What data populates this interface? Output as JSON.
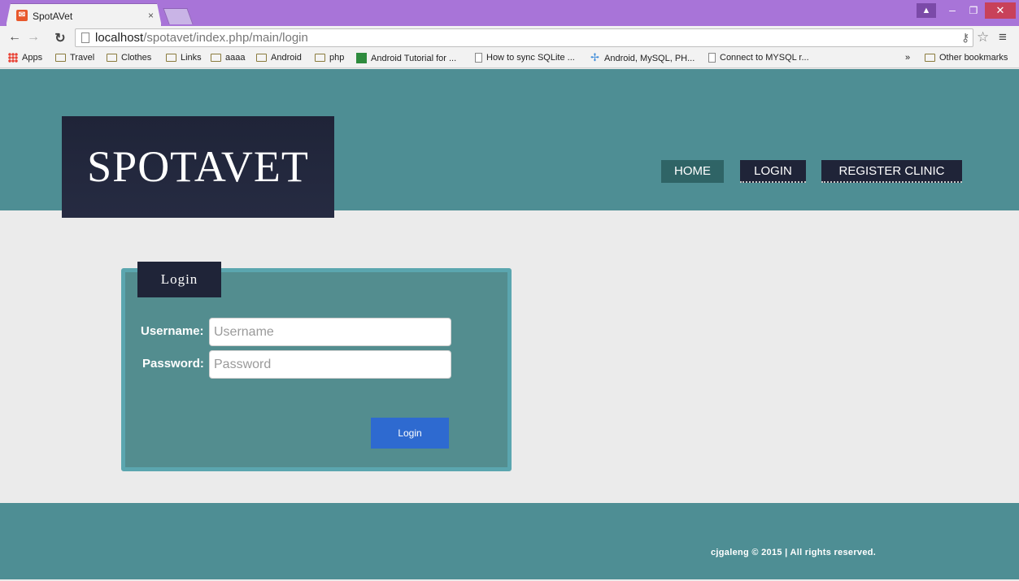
{
  "browser": {
    "tab_title": "SpotAVet",
    "tab_close": "×",
    "url_host": "localhost",
    "url_path": "/spotavet/index.php/main/login",
    "bookmarks": [
      {
        "label": "Apps",
        "icon": "apps-grid-icon"
      },
      {
        "label": "Travel",
        "icon": "folder-icon"
      },
      {
        "label": "Clothes",
        "icon": "folder-icon"
      },
      {
        "label": "Links",
        "icon": "folder-icon"
      },
      {
        "label": "aaaa",
        "icon": "folder-icon"
      },
      {
        "label": "Android",
        "icon": "folder-icon"
      },
      {
        "label": "php",
        "icon": "folder-icon"
      },
      {
        "label": "Android Tutorial for ...",
        "icon": "site-icon"
      },
      {
        "label": "How to sync SQLite ...",
        "icon": "page-icon"
      },
      {
        "label": "Android, MySQL, PH...",
        "icon": "site-icon"
      },
      {
        "label": "Connect to MYSQL r...",
        "icon": "page-icon"
      }
    ],
    "overflow": "»",
    "other_bookmarks": "Other bookmarks"
  },
  "header": {
    "logo": "SPOTAVET",
    "nav": {
      "home": "HOME",
      "login": "LOGIN",
      "register": "REGISTER CLINIC"
    }
  },
  "login_form": {
    "title": "Login",
    "username_label": "Username:",
    "username_placeholder": "Username",
    "password_label": "Password:",
    "password_placeholder": "Password",
    "submit": "Login"
  },
  "footer": {
    "text": "cjgaleng © 2015 | All rights reserved."
  }
}
